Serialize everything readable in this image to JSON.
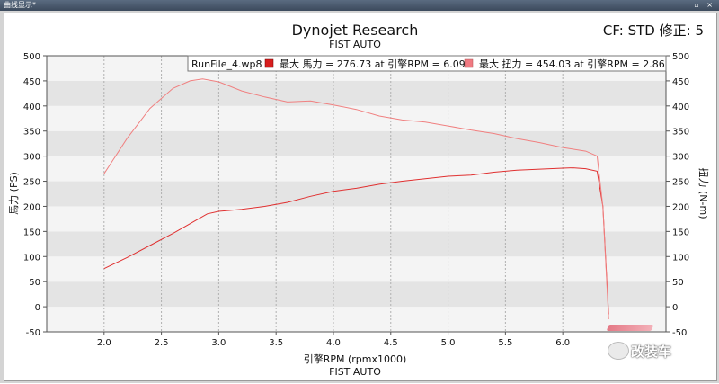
{
  "window": {
    "title": "曲线显示*",
    "buttons": "▫ ×"
  },
  "header": {
    "title": "Dynojet Research",
    "subtitle": "FIST AUTO",
    "cf_label": "CF: STD 修正: 5"
  },
  "legend": {
    "run_file": "RunFile_4.wp8",
    "hp_entry": "最大 馬力 = 276.73 at 引擎RPM = 6.09",
    "tq_entry": "最大 扭力 = 454.03 at 引擎RPM = 2.86"
  },
  "watermark": {
    "text": "改装车"
  },
  "chart_data": {
    "type": "line",
    "title": "Dynojet Research",
    "subtitle": "FIST AUTO",
    "xlabel": "引擎RPM (rpmx1000)",
    "xlabel_secondary": "FIST AUTO",
    "ylabel": "馬力 (PS)",
    "y2label": "扭力 (N-m)",
    "xlim": [
      1.5,
      6.9
    ],
    "ylim": [
      -50,
      500
    ],
    "y2lim": [
      -50,
      500
    ],
    "x_ticks": [
      "2.0",
      "2.5",
      "3.0",
      "3.5",
      "4.0",
      "4.5",
      "5.0",
      "5.5",
      "6.0"
    ],
    "y_ticks": [
      "-50",
      "0",
      "50",
      "100",
      "150",
      "200",
      "250",
      "300",
      "350",
      "400",
      "450",
      "500"
    ],
    "grid": true,
    "series": [
      {
        "name": "最大 馬力 = 276.73 at 引擎RPM = 6.09",
        "color": "#e03030",
        "x": [
          2.0,
          2.2,
          2.4,
          2.6,
          2.8,
          2.9,
          3.0,
          3.2,
          3.4,
          3.6,
          3.8,
          4.0,
          4.2,
          4.4,
          4.6,
          4.8,
          5.0,
          5.2,
          5.4,
          5.6,
          5.8,
          6.0,
          6.09,
          6.2,
          6.3,
          6.35,
          6.4
        ],
        "values": [
          76,
          98,
          122,
          146,
          172,
          185,
          190,
          194,
          200,
          208,
          220,
          230,
          236,
          244,
          250,
          255,
          260,
          262,
          268,
          272,
          274,
          276,
          276.73,
          275,
          270,
          200,
          -15
        ]
      },
      {
        "name": "最大 扭力 = 454.03 at 引擎RPM = 2.86",
        "color": "#f08080",
        "x": [
          2.0,
          2.2,
          2.4,
          2.6,
          2.75,
          2.86,
          3.0,
          3.2,
          3.4,
          3.6,
          3.8,
          4.0,
          4.2,
          4.4,
          4.6,
          4.8,
          5.0,
          5.2,
          5.4,
          5.6,
          5.8,
          6.0,
          6.2,
          6.3,
          6.35,
          6.4
        ],
        "values": [
          265,
          335,
          395,
          435,
          450,
          454.03,
          448,
          430,
          418,
          408,
          410,
          402,
          393,
          380,
          372,
          368,
          360,
          352,
          345,
          335,
          327,
          317,
          310,
          300,
          200,
          -25
        ]
      }
    ]
  }
}
